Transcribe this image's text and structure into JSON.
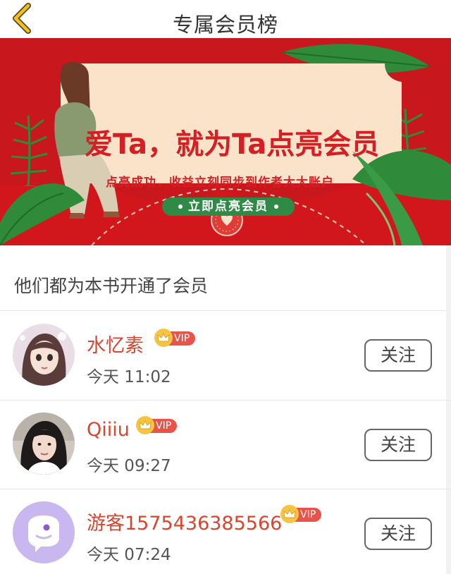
{
  "header": {
    "title": "专属会员榜",
    "back_icon": "chevron-left-icon",
    "accent_color": "#f0c020"
  },
  "banner": {
    "headline": "爱Ta，就为Ta点亮会员",
    "subtitle": "点亮成功，收益立刻同步到作者大大账户",
    "button_label": "立即点亮会员",
    "background_color": "#c8171d",
    "card_color": "#fbe3c9",
    "button_color": "#2e8a45"
  },
  "section": {
    "title": "他们都为本书开通了会员"
  },
  "members": [
    {
      "name": "水忆素",
      "badge": "VIP",
      "time": "今天 11:02",
      "follow_label": "关注",
      "avatar": "illustrated-girl-avatar"
    },
    {
      "name": "Qiiiu",
      "badge": "VIP",
      "time": "今天 09:27",
      "follow_label": "关注",
      "avatar": "photo-woman-avatar"
    },
    {
      "name": "游客1575436385566",
      "badge": "VIP",
      "time": "今天 07:24",
      "follow_label": "关注",
      "avatar": "default-chat-bubble-avatar"
    }
  ],
  "colors": {
    "name_color": "#d9452e",
    "vip_pill": "#e8534a",
    "vip_crown": "#f5c542"
  }
}
